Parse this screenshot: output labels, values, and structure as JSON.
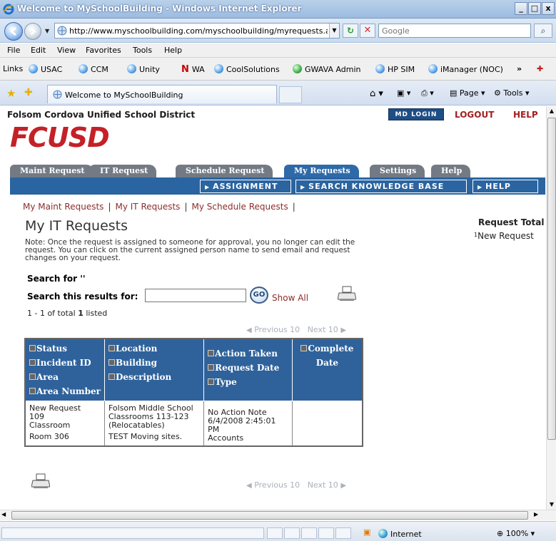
{
  "window": {
    "title": "Welcome to MySchoolBuilding - Windows Internet Explorer",
    "min": "_",
    "max": "□",
    "close": "x"
  },
  "address": {
    "url": "http://www.myschoolbuilding.com/myschoolbuilding/myrequests.as",
    "search_placeholder": "Google"
  },
  "menu": [
    "File",
    "Edit",
    "View",
    "Favorites",
    "Tools",
    "Help"
  ],
  "links": {
    "label": "Links",
    "items": [
      "USAC",
      "CCM",
      "Unity",
      "WA",
      "CoolSolutions",
      "GWAVA Admin",
      "HP SIM",
      "iManager (NOC)"
    ],
    "overflow": "»"
  },
  "tab": {
    "title": "Welcome to MySchoolBuilding",
    "commands": [
      "Page",
      "Tools"
    ]
  },
  "site": {
    "org_name": "Folsom Cordova Unified School District",
    "logo": "FCUSD",
    "md_login": "MD LOGIN",
    "logout": "LOGOUT",
    "help": "HELP"
  },
  "app_tabs": [
    "Maint Request",
    "IT Request",
    "Schedule Request",
    "My Requests",
    "Settings",
    "Help"
  ],
  "active_tab": "My Requests",
  "sub_buttons": [
    "ASSIGNMENT",
    "SEARCH KNOWLEDGE BASE",
    "HELP"
  ],
  "sub_links": [
    "My Maint Requests",
    "My IT Requests",
    "My Schedule Requests"
  ],
  "sub_links_sep": "|",
  "page": {
    "title": "My IT Requests",
    "note": "Note: Once the request is assigned to someone for approval, you no longer can edit the request. You can click on the current assigned person name to send email and request changes on your request.",
    "search_for": "Search for ''",
    "search_results_label": "Search this results for:",
    "search_value": "",
    "go": "GO",
    "show_all": "Show All",
    "listed_prefix": "1 - 1 of total ",
    "listed_count": "1",
    "listed_suffix": " listed",
    "previous": "Previous 10",
    "next": "Next 10"
  },
  "table": {
    "headers": [
      [
        "Status",
        "Incident ID",
        "Area",
        "Area Number"
      ],
      [
        "Location",
        "Building",
        "Description"
      ],
      [
        "Action Taken",
        "Request Date",
        "Type"
      ],
      [
        "Complete Date"
      ]
    ],
    "rows": [
      {
        "col1": [
          "New Request",
          "109",
          "Classroom",
          "Room 306"
        ],
        "col2": [
          "Folsom Middle School",
          "Classrooms 113-123 (Relocatables)",
          "TEST Moving sites."
        ],
        "col3": [
          "No Action Note",
          "6/4/2008 2:45:01 PM",
          "Accounts"
        ],
        "col4": []
      }
    ]
  },
  "request_total": {
    "label": "Request Total",
    "count": "1",
    "item": "New Request"
  },
  "status": {
    "zone": "Internet",
    "zoom": "100%"
  },
  "colors": {
    "tab_bar_blue": "#2a64a1",
    "table_header_blue": "#2f629b",
    "link_red": "#8c2d2d",
    "logo_red": "#c42127"
  }
}
